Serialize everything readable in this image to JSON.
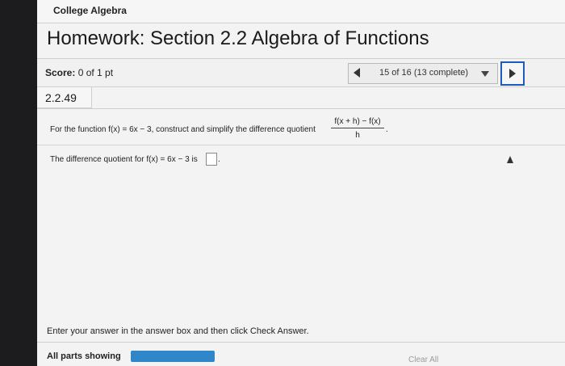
{
  "course": {
    "title": "College Algebra"
  },
  "homework": {
    "title": "Homework: Section 2.2 Algebra of Functions"
  },
  "score": {
    "label": "Score:",
    "value": "0 of 1 pt"
  },
  "navigation": {
    "progress": "15 of 16 (13 complete)",
    "prev_icon": "triangle-left-icon",
    "next_icon": "triangle-right-icon",
    "dropdown_icon": "caret-down-icon"
  },
  "problem": {
    "id": "2.2.49",
    "question": "For the function f(x) = 6x − 3, construct and simplify the difference quotient",
    "fraction_numerator": "f(x + h) − f(x)",
    "fraction_denominator": "h",
    "question_end": ".",
    "answer_prompt": "The difference quotient for f(x) = 6x − 3 is",
    "answer_value": "",
    "answer_end": "."
  },
  "footer": {
    "instructions": "Enter your answer in the answer box and then click Check Answer.",
    "all_parts": "All parts showing",
    "clear_all": "Clear All"
  },
  "colors": {
    "accent": "#1f5bb8",
    "progress_bar": "#2f86c8"
  }
}
